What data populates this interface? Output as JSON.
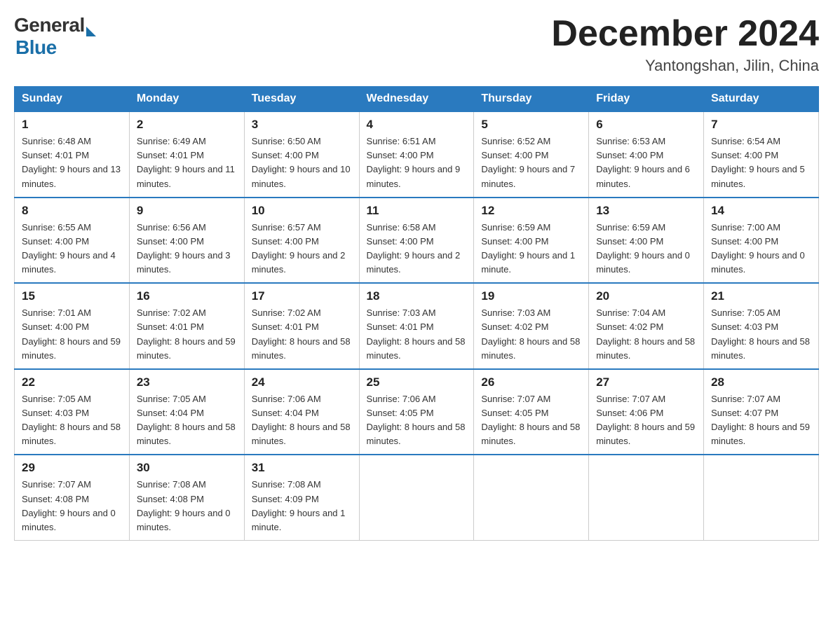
{
  "header": {
    "logo_general": "General",
    "logo_blue": "Blue",
    "month_title": "December 2024",
    "location": "Yantongshan, Jilin, China"
  },
  "days_of_week": [
    "Sunday",
    "Monday",
    "Tuesday",
    "Wednesday",
    "Thursday",
    "Friday",
    "Saturday"
  ],
  "weeks": [
    [
      {
        "day": "1",
        "sunrise": "6:48 AM",
        "sunset": "4:01 PM",
        "daylight": "9 hours and 13 minutes."
      },
      {
        "day": "2",
        "sunrise": "6:49 AM",
        "sunset": "4:01 PM",
        "daylight": "9 hours and 11 minutes."
      },
      {
        "day": "3",
        "sunrise": "6:50 AM",
        "sunset": "4:00 PM",
        "daylight": "9 hours and 10 minutes."
      },
      {
        "day": "4",
        "sunrise": "6:51 AM",
        "sunset": "4:00 PM",
        "daylight": "9 hours and 9 minutes."
      },
      {
        "day": "5",
        "sunrise": "6:52 AM",
        "sunset": "4:00 PM",
        "daylight": "9 hours and 7 minutes."
      },
      {
        "day": "6",
        "sunrise": "6:53 AM",
        "sunset": "4:00 PM",
        "daylight": "9 hours and 6 minutes."
      },
      {
        "day": "7",
        "sunrise": "6:54 AM",
        "sunset": "4:00 PM",
        "daylight": "9 hours and 5 minutes."
      }
    ],
    [
      {
        "day": "8",
        "sunrise": "6:55 AM",
        "sunset": "4:00 PM",
        "daylight": "9 hours and 4 minutes."
      },
      {
        "day": "9",
        "sunrise": "6:56 AM",
        "sunset": "4:00 PM",
        "daylight": "9 hours and 3 minutes."
      },
      {
        "day": "10",
        "sunrise": "6:57 AM",
        "sunset": "4:00 PM",
        "daylight": "9 hours and 2 minutes."
      },
      {
        "day": "11",
        "sunrise": "6:58 AM",
        "sunset": "4:00 PM",
        "daylight": "9 hours and 2 minutes."
      },
      {
        "day": "12",
        "sunrise": "6:59 AM",
        "sunset": "4:00 PM",
        "daylight": "9 hours and 1 minute."
      },
      {
        "day": "13",
        "sunrise": "6:59 AM",
        "sunset": "4:00 PM",
        "daylight": "9 hours and 0 minutes."
      },
      {
        "day": "14",
        "sunrise": "7:00 AM",
        "sunset": "4:00 PM",
        "daylight": "9 hours and 0 minutes."
      }
    ],
    [
      {
        "day": "15",
        "sunrise": "7:01 AM",
        "sunset": "4:00 PM",
        "daylight": "8 hours and 59 minutes."
      },
      {
        "day": "16",
        "sunrise": "7:02 AM",
        "sunset": "4:01 PM",
        "daylight": "8 hours and 59 minutes."
      },
      {
        "day": "17",
        "sunrise": "7:02 AM",
        "sunset": "4:01 PM",
        "daylight": "8 hours and 58 minutes."
      },
      {
        "day": "18",
        "sunrise": "7:03 AM",
        "sunset": "4:01 PM",
        "daylight": "8 hours and 58 minutes."
      },
      {
        "day": "19",
        "sunrise": "7:03 AM",
        "sunset": "4:02 PM",
        "daylight": "8 hours and 58 minutes."
      },
      {
        "day": "20",
        "sunrise": "7:04 AM",
        "sunset": "4:02 PM",
        "daylight": "8 hours and 58 minutes."
      },
      {
        "day": "21",
        "sunrise": "7:05 AM",
        "sunset": "4:03 PM",
        "daylight": "8 hours and 58 minutes."
      }
    ],
    [
      {
        "day": "22",
        "sunrise": "7:05 AM",
        "sunset": "4:03 PM",
        "daylight": "8 hours and 58 minutes."
      },
      {
        "day": "23",
        "sunrise": "7:05 AM",
        "sunset": "4:04 PM",
        "daylight": "8 hours and 58 minutes."
      },
      {
        "day": "24",
        "sunrise": "7:06 AM",
        "sunset": "4:04 PM",
        "daylight": "8 hours and 58 minutes."
      },
      {
        "day": "25",
        "sunrise": "7:06 AM",
        "sunset": "4:05 PM",
        "daylight": "8 hours and 58 minutes."
      },
      {
        "day": "26",
        "sunrise": "7:07 AM",
        "sunset": "4:05 PM",
        "daylight": "8 hours and 58 minutes."
      },
      {
        "day": "27",
        "sunrise": "7:07 AM",
        "sunset": "4:06 PM",
        "daylight": "8 hours and 59 minutes."
      },
      {
        "day": "28",
        "sunrise": "7:07 AM",
        "sunset": "4:07 PM",
        "daylight": "8 hours and 59 minutes."
      }
    ],
    [
      {
        "day": "29",
        "sunrise": "7:07 AM",
        "sunset": "4:08 PM",
        "daylight": "9 hours and 0 minutes."
      },
      {
        "day": "30",
        "sunrise": "7:08 AM",
        "sunset": "4:08 PM",
        "daylight": "9 hours and 0 minutes."
      },
      {
        "day": "31",
        "sunrise": "7:08 AM",
        "sunset": "4:09 PM",
        "daylight": "9 hours and 1 minute."
      },
      null,
      null,
      null,
      null
    ]
  ]
}
